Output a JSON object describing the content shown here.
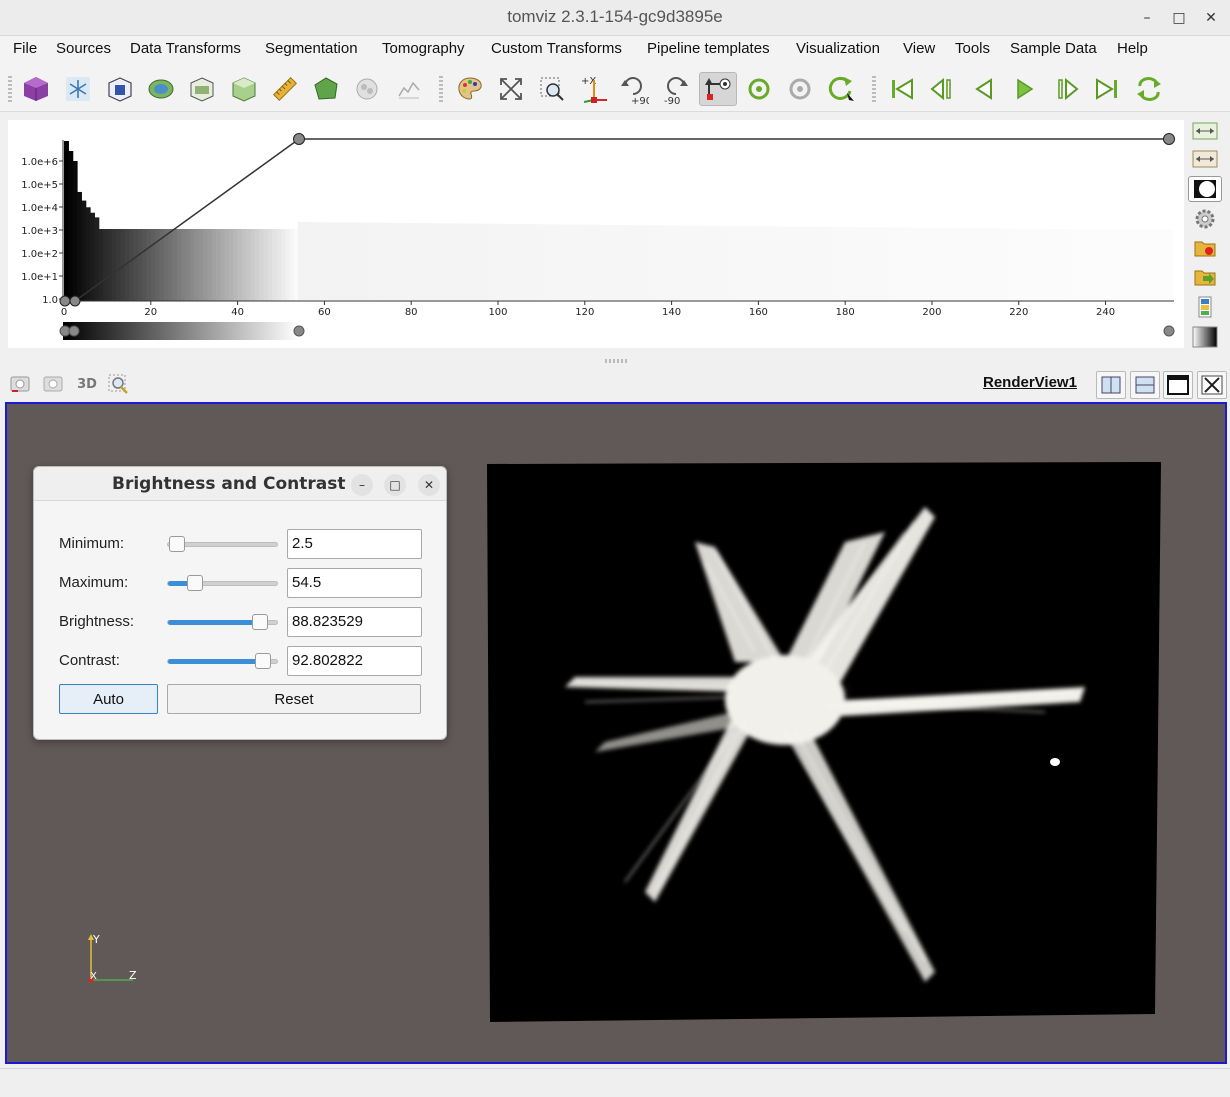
{
  "window": {
    "title": "tomviz 2.3.1-154-gc9d3895e",
    "minimize": "–",
    "maximize": "□",
    "close": "✕"
  },
  "menu": [
    "File",
    "Sources",
    "Data Transforms",
    "Segmentation",
    "Tomography",
    "Custom Transforms",
    "Pipeline templates",
    "Visualization",
    "View",
    "Tools",
    "Sample Data",
    "Help"
  ],
  "toolbar": {
    "rotate_plus_label": "+90",
    "rotate_minus_label": "-90",
    "set_axis_label": "+X",
    "icons": [
      "cube-icon",
      "snowflake-icon",
      "box-outline-icon",
      "contour-icon",
      "slice-icon",
      "volume-icon",
      "ruler-icon",
      "threshold-icon",
      "segment-icon",
      "histogram-icon",
      "palette-icon",
      "reset-zoom-icon",
      "zoom-to-box-icon",
      "set-axis-icon",
      "rotate-plus-90-icon",
      "rotate-minus-90-icon",
      "interact-icon",
      "rotate-icon",
      "rotate-camera-icon",
      "rotate-view-icon",
      "first-frame-icon",
      "previous-frame-icon",
      "reverse-icon",
      "play-icon",
      "next-frame-icon",
      "last-frame-icon",
      "loop-icon"
    ]
  },
  "histogram": {
    "y_ticks": [
      "1.0e+6",
      "1.0e+5",
      "1.0e+4",
      "1.0e+3",
      "1.0e+2",
      "1.0e+1",
      "1.0"
    ],
    "x_ticks": [
      "0",
      "20",
      "40",
      "60",
      "80",
      "100",
      "120",
      "140",
      "160",
      "180",
      "200",
      "220",
      "240"
    ]
  },
  "view_toolbar": {
    "mode_3d": "3D",
    "render_view_name": "RenderView1"
  },
  "brightness_contrast": {
    "title": "Brightness and Contrast",
    "rows": [
      {
        "label": "Minimum:",
        "value": "2.5",
        "fraction": 0.08,
        "filled": false
      },
      {
        "label": "Maximum:",
        "value": "54.5",
        "fraction": 0.25,
        "filled": true
      },
      {
        "label": "Brightness:",
        "value": "88.823529",
        "fraction": 0.84,
        "filled": true
      },
      {
        "label": "Contrast:",
        "value": "92.802822",
        "fraction": 0.87,
        "filled": true
      }
    ],
    "auto_label": "Auto",
    "reset_label": "Reset"
  },
  "axes": {
    "y": "Y",
    "x": "X",
    "z": "Z"
  },
  "colors": {
    "selection_border": "#1a1ad6",
    "render_bg": "#615957",
    "slider_fill": "#3b8ed8"
  }
}
